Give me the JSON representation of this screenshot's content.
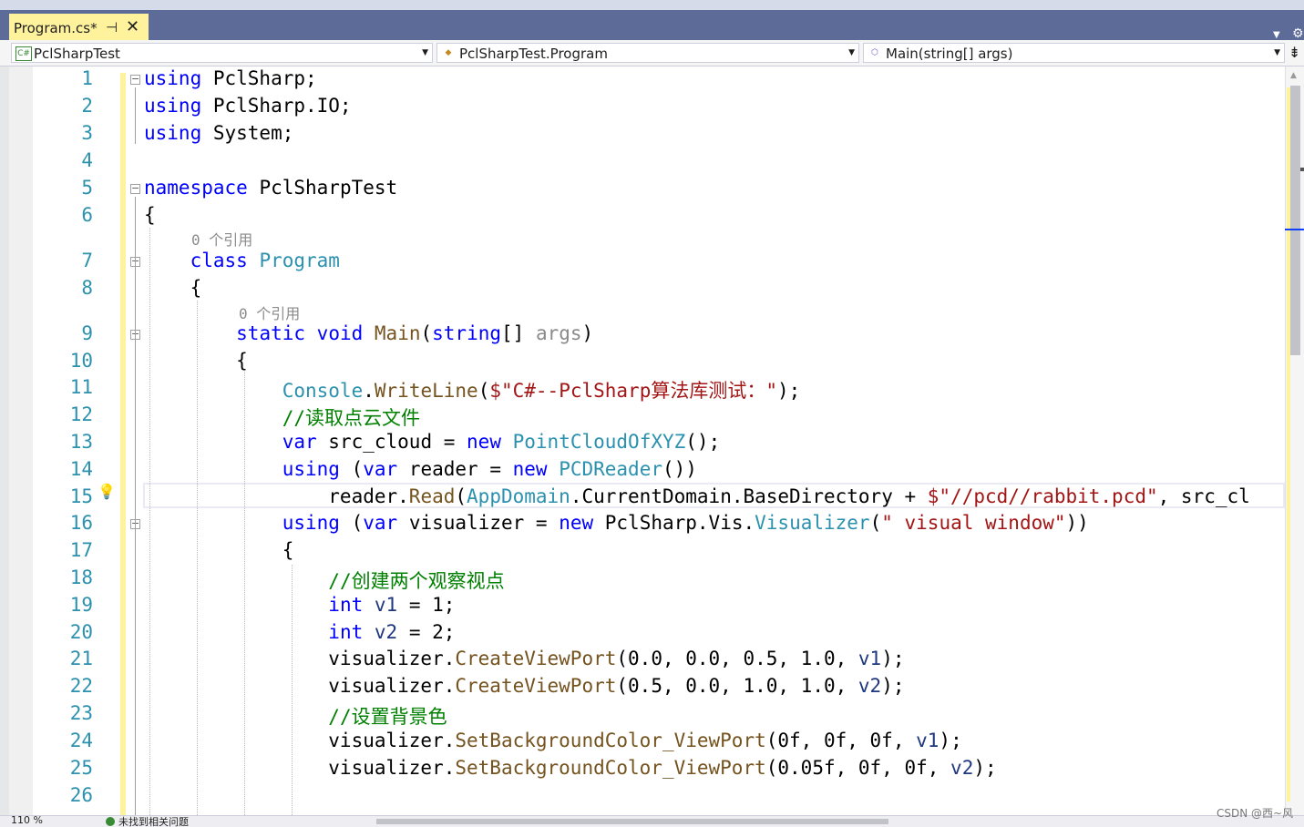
{
  "tab": {
    "label": "Program.cs*",
    "pin_icon": "pin-icon",
    "close_glyph": "✕"
  },
  "nav": {
    "project": "PclSharpTest",
    "type": "PclSharpTest.Program",
    "member": "Main(string[] args)",
    "project_icon": "C#"
  },
  "refs_label": "0 个引用",
  "lines": [
    {
      "n": "1",
      "tokens": [
        {
          "c": "kw",
          "t": "using"
        },
        {
          "c": "",
          "t": " PclSharp;"
        }
      ]
    },
    {
      "n": "2",
      "tokens": [
        {
          "c": "kw",
          "t": "using"
        },
        {
          "c": "",
          "t": " PclSharp.IO;"
        }
      ]
    },
    {
      "n": "3",
      "tokens": [
        {
          "c": "kw",
          "t": "using"
        },
        {
          "c": "",
          "t": " System;"
        }
      ]
    },
    {
      "n": "4",
      "tokens": []
    },
    {
      "n": "5",
      "tokens": [
        {
          "c": "kw",
          "t": "namespace"
        },
        {
          "c": "",
          "t": " PclSharpTest"
        }
      ]
    },
    {
      "n": "6",
      "tokens": [
        {
          "c": "",
          "t": "{"
        }
      ]
    },
    {
      "n": "7",
      "tokens": [
        {
          "c": "",
          "t": "    "
        },
        {
          "c": "kw",
          "t": "class"
        },
        {
          "c": "",
          "t": " "
        },
        {
          "c": "ty",
          "t": "Program"
        }
      ]
    },
    {
      "n": "8",
      "tokens": [
        {
          "c": "",
          "t": "    {"
        }
      ]
    },
    {
      "n": "9",
      "tokens": [
        {
          "c": "",
          "t": "        "
        },
        {
          "c": "kw",
          "t": "static"
        },
        {
          "c": "",
          "t": " "
        },
        {
          "c": "kw",
          "t": "void"
        },
        {
          "c": "",
          "t": " "
        },
        {
          "c": "me",
          "t": "Main"
        },
        {
          "c": "",
          "t": "("
        },
        {
          "c": "kw",
          "t": "string"
        },
        {
          "c": "",
          "t": "[] "
        },
        {
          "c": "un",
          "t": "args"
        },
        {
          "c": "",
          "t": ")"
        }
      ]
    },
    {
      "n": "10",
      "tokens": [
        {
          "c": "",
          "t": "        {"
        }
      ]
    },
    {
      "n": "11",
      "tokens": [
        {
          "c": "",
          "t": "            "
        },
        {
          "c": "ty",
          "t": "Console"
        },
        {
          "c": "",
          "t": "."
        },
        {
          "c": "me",
          "t": "WriteLine"
        },
        {
          "c": "",
          "t": "("
        },
        {
          "c": "st",
          "t": "$\"C#--PclSharp算法库测试：\""
        },
        {
          "c": "",
          "t": ");"
        }
      ]
    },
    {
      "n": "12",
      "tokens": [
        {
          "c": "",
          "t": "            "
        },
        {
          "c": "cm",
          "t": "//读取点云文件"
        }
      ]
    },
    {
      "n": "13",
      "tokens": [
        {
          "c": "",
          "t": "            "
        },
        {
          "c": "kw",
          "t": "var"
        },
        {
          "c": "",
          "t": " src_cloud = "
        },
        {
          "c": "kw",
          "t": "new"
        },
        {
          "c": "",
          "t": " "
        },
        {
          "c": "ty",
          "t": "PointCloudOfXYZ"
        },
        {
          "c": "",
          "t": "();"
        }
      ]
    },
    {
      "n": "14",
      "tokens": [
        {
          "c": "",
          "t": "            "
        },
        {
          "c": "kw",
          "t": "using"
        },
        {
          "c": "",
          "t": " ("
        },
        {
          "c": "kw",
          "t": "var"
        },
        {
          "c": "",
          "t": " reader = "
        },
        {
          "c": "kw",
          "t": "new"
        },
        {
          "c": "",
          "t": " "
        },
        {
          "c": "ty",
          "t": "PCDReader"
        },
        {
          "c": "",
          "t": "())"
        }
      ]
    },
    {
      "n": "15",
      "tokens": [
        {
          "c": "",
          "t": "                reader."
        },
        {
          "c": "me",
          "t": "Read"
        },
        {
          "c": "",
          "t": "("
        },
        {
          "c": "ty",
          "t": "AppDomain"
        },
        {
          "c": "",
          "t": ".CurrentDomain.BaseDirectory + "
        },
        {
          "c": "st",
          "t": "$\"//pcd//rabbit.pcd\""
        },
        {
          "c": "",
          "t": ", src_cl"
        }
      ]
    },
    {
      "n": "16",
      "tokens": [
        {
          "c": "",
          "t": "            "
        },
        {
          "c": "kw",
          "t": "using"
        },
        {
          "c": "",
          "t": " ("
        },
        {
          "c": "kw",
          "t": "var"
        },
        {
          "c": "",
          "t": " visualizer = "
        },
        {
          "c": "kw",
          "t": "new"
        },
        {
          "c": "",
          "t": " PclSharp.Vis."
        },
        {
          "c": "ty",
          "t": "Visualizer"
        },
        {
          "c": "",
          "t": "("
        },
        {
          "c": "st",
          "t": "\" visual window\""
        },
        {
          "c": "",
          "t": "))"
        }
      ]
    },
    {
      "n": "17",
      "tokens": [
        {
          "c": "",
          "t": "            {"
        }
      ]
    },
    {
      "n": "18",
      "tokens": [
        {
          "c": "",
          "t": "                "
        },
        {
          "c": "cm",
          "t": "//创建两个观察视点"
        }
      ]
    },
    {
      "n": "19",
      "tokens": [
        {
          "c": "",
          "t": "                "
        },
        {
          "c": "kw",
          "t": "int"
        },
        {
          "c": "",
          "t": " "
        },
        {
          "c": "pa",
          "t": "v1"
        },
        {
          "c": "",
          "t": " = 1;"
        }
      ]
    },
    {
      "n": "20",
      "tokens": [
        {
          "c": "",
          "t": "                "
        },
        {
          "c": "kw",
          "t": "int"
        },
        {
          "c": "",
          "t": " "
        },
        {
          "c": "pa",
          "t": "v2"
        },
        {
          "c": "",
          "t": " = 2;"
        }
      ]
    },
    {
      "n": "21",
      "tokens": [
        {
          "c": "",
          "t": "                visualizer."
        },
        {
          "c": "me",
          "t": "CreateViewPort"
        },
        {
          "c": "",
          "t": "(0.0, 0.0, 0.5, 1.0, "
        },
        {
          "c": "pa",
          "t": "v1"
        },
        {
          "c": "",
          "t": ");"
        }
      ]
    },
    {
      "n": "22",
      "tokens": [
        {
          "c": "",
          "t": "                visualizer."
        },
        {
          "c": "me",
          "t": "CreateViewPort"
        },
        {
          "c": "",
          "t": "(0.5, 0.0, 1.0, 1.0, "
        },
        {
          "c": "pa",
          "t": "v2"
        },
        {
          "c": "",
          "t": ");"
        }
      ]
    },
    {
      "n": "23",
      "tokens": [
        {
          "c": "",
          "t": "                "
        },
        {
          "c": "cm",
          "t": "//设置背景色"
        }
      ]
    },
    {
      "n": "24",
      "tokens": [
        {
          "c": "",
          "t": "                visualizer."
        },
        {
          "c": "me",
          "t": "SetBackgroundColor_ViewPort"
        },
        {
          "c": "",
          "t": "(0f, 0f, 0f, "
        },
        {
          "c": "pa",
          "t": "v1"
        },
        {
          "c": "",
          "t": ");"
        }
      ]
    },
    {
      "n": "25",
      "tokens": [
        {
          "c": "",
          "t": "                visualizer."
        },
        {
          "c": "me",
          "t": "SetBackgroundColor_ViewPort"
        },
        {
          "c": "",
          "t": "(0.05f, 0f, 0f, "
        },
        {
          "c": "pa",
          "t": "v2"
        },
        {
          "c": "",
          "t": ");"
        }
      ]
    },
    {
      "n": "26",
      "tokens": []
    }
  ],
  "status": {
    "zoom": "110 %",
    "issues": "未找到相关问题"
  },
  "watermark": "CSDN @西~风",
  "colors": {
    "keyword": "#0000ff",
    "type": "#2b91af",
    "string": "#a31515",
    "comment": "#008000",
    "tab_active": "#fff29d",
    "tabbar": "#5d6b99"
  }
}
